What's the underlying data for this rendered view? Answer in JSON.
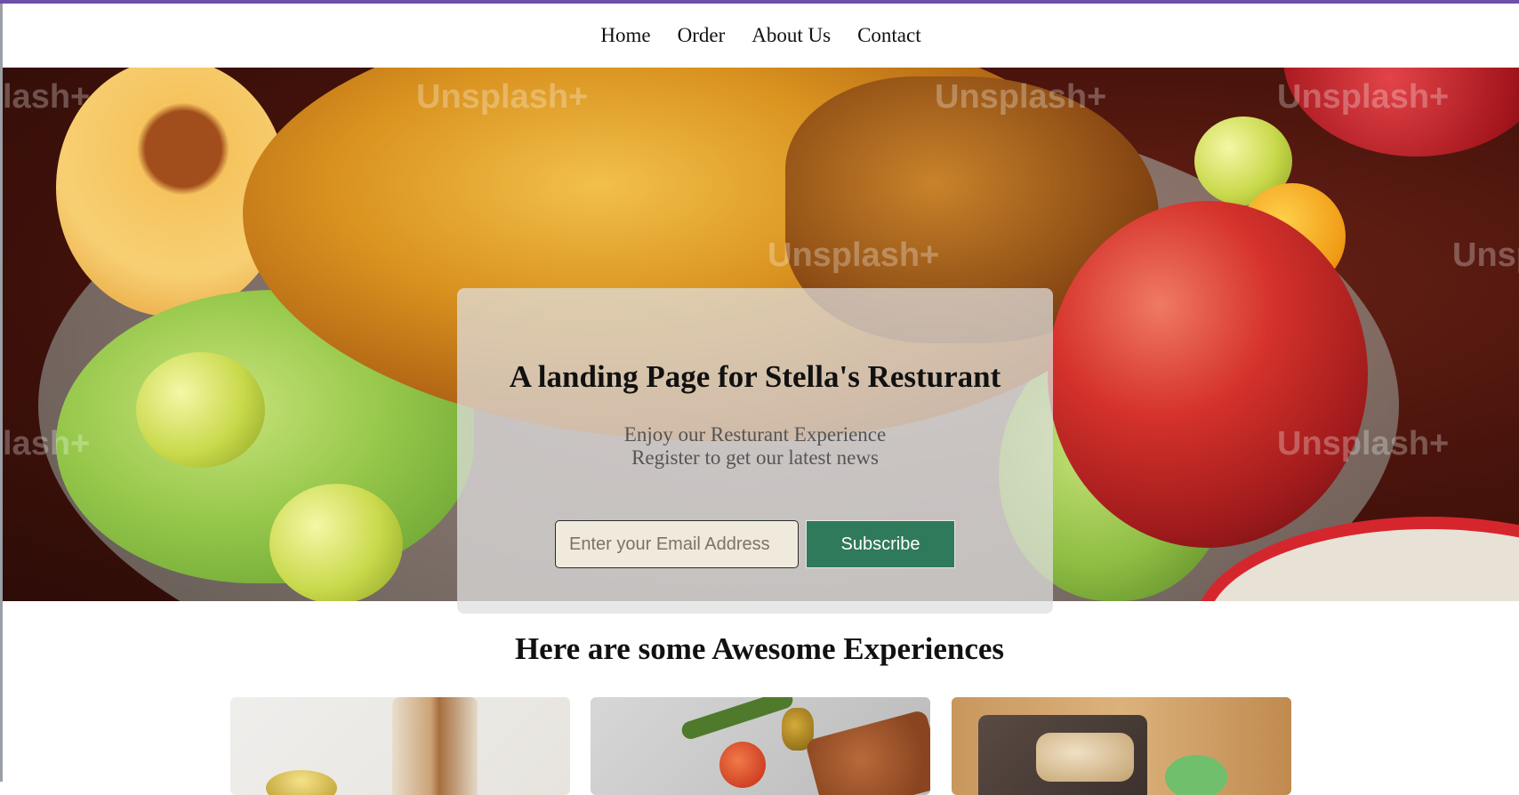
{
  "nav": {
    "items": [
      {
        "label": "Home"
      },
      {
        "label": "Order"
      },
      {
        "label": "About Us"
      },
      {
        "label": "Contact"
      }
    ]
  },
  "hero": {
    "title": "A landing Page for Stella's Resturant",
    "subtitle_line1": "Enjoy our Resturant Experience",
    "subtitle_line2": "Register to get our latest news",
    "email_placeholder": "Enter your Email Address",
    "subscribe_label": "Subscribe",
    "watermark_text": "Unsplash+",
    "watermark_text_partial": "lash+"
  },
  "experiences": {
    "title": "Here are some Awesome Experiences"
  },
  "colors": {
    "accent_bar": "#6f4fa7",
    "subscribe_button": "#2f7a5a",
    "text_dark": "#111111",
    "text_muted": "#555555"
  }
}
